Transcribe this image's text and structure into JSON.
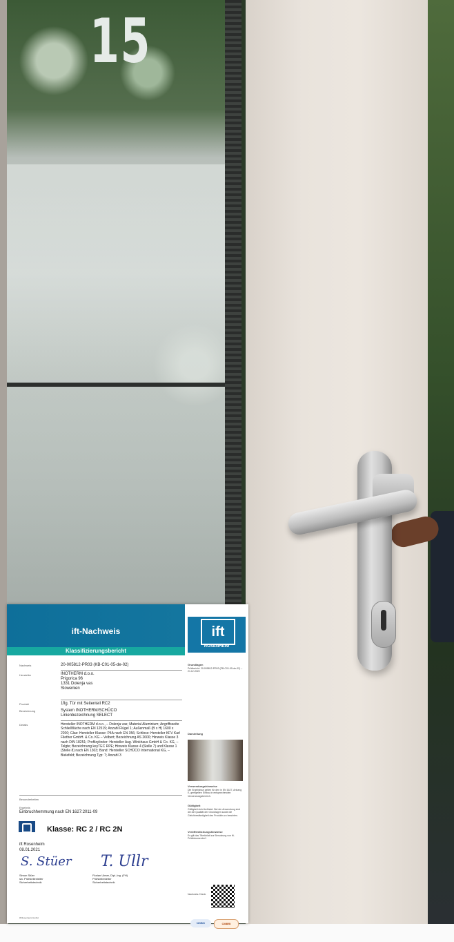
{
  "scene": {
    "door_number": "15"
  },
  "certificate": {
    "header_title": "ift-Nachweis",
    "header_subtitle": "Klassifizierungsbericht",
    "logo_text": "ift",
    "logo_subtext": "ROSENHEIM",
    "rows": [
      {
        "label": "Nachweis",
        "value": "20-005812-PR03 (KB-C01-05-de-02)"
      },
      {
        "label": "Hersteller",
        "value": "INOTHERM d.o.o.\nPrigorica 96\n1331 Dolenja vas\nSlowenien"
      },
      {
        "label": "Produkt",
        "value": "1flg. Tür mit Seitenteil RC2"
      },
      {
        "label": "Bezeichnung",
        "value": "System INOTHERM/SCHÜCO\nLinienbezeichnung SELECT"
      }
    ],
    "details_label": "Details",
    "details_text": "Hersteller INOTHERM d.o.o., – Dolenja vas; Material Aluminium; Angriffsseite Schließfläche nach EN 12519; Anzahl Flügel 1; Außenmaß (B x H) 1600 x 2200; Glas: Hersteller Klasse: P4A nach EN 356; Schloss: Hersteller KFV Karl Fliether GmbH. & Co. KG – Velbert; Bezeichnung AS 2600; Hinweis Klasse 3 nach DIN 18251; Profilzylinder: Hersteller Aug. Winkhaus GmbH & Co. KG, – Telgte; Bezeichnung keyTEC RPE; Hinweis Klasse 4 (Stelle 7) und Klasse 1 (Stelle 8) nach EN 1303; Band: Hersteller SCHÜCO International KG, – Bielefeld; Bezeichnung Typ: 7; Anzahl 3",
    "besonderheiten_label": "Besonderheiten",
    "ergebnis_label": "Ergebnis",
    "ergebnis_text": "Einbruchhemmung nach EN 1627:2011-09",
    "klasse": "Klasse: RC 2 / RC 2N",
    "place": "ift Rosenheim",
    "date": "08.01.2021",
    "signer1_sig": "S. Stüer",
    "signer1_name": "Simon Stüer\nstv. Prüfstellenleiter\nSicherheitstechnik",
    "signer2_sig": "T. Ullr",
    "signer2_name": "Florian Ulmer, Dipl.-Ing. (FH)\nPrüfstellenleiter\nSicherheitstechnik",
    "side_grundlagen_title": "Grundlagen",
    "side_grundlagen_text": "Prüfbericht: 20-005812-PR03 (PB-C01-05-de-02) – 21.12.2020",
    "side_darstellung_title": "Darstellung",
    "side_hinweise_title": "Verwendungshinweise",
    "side_hinweise_text": "Die Ergebnisse gelten für den in EN 1627, Anhang E, geregelten Einbau in entsprechenden Verwendungsbereich.",
    "side_gueltigkeit_title": "Gültigkeit",
    "side_gueltigkeit_text": "Gültigkeit nicht befristet. Bei der Anwendung sind die die Qualität der Grundlagen sowie die Gleichbeständigkeit des Produkts zu beachten.",
    "side_veroeff_title": "Veröffentlichungshinweise",
    "side_veroeff_text": "Es gilt das \"Merkblatt zur Benutzung von ift-Prüfdokumenten\".",
    "side_qr_label": "Nachweis-Check",
    "footer_company": "ift Rosenheim GmbH",
    "badge1": "NOBO",
    "badge2": "CMBRI"
  }
}
